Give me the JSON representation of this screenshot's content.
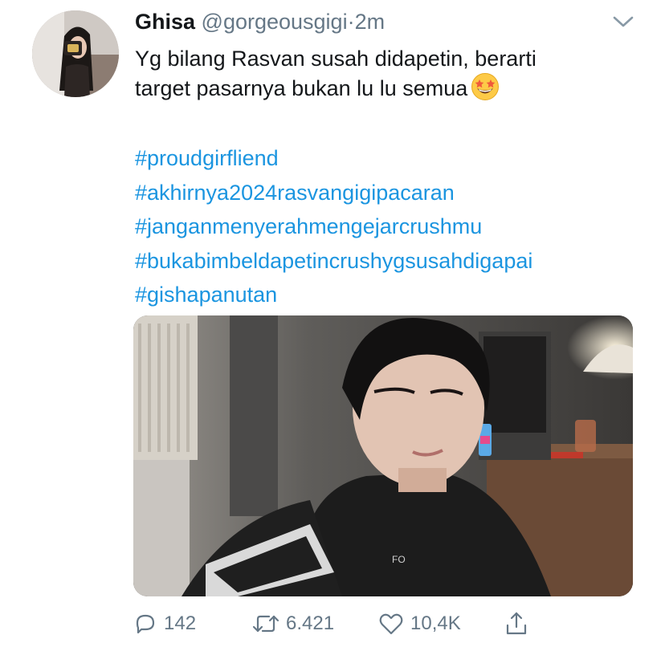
{
  "tweet": {
    "author_name": "Ghisa",
    "author_handle": "@gorgeousgigi",
    "separator": "·",
    "time": "2m",
    "text_lines": [
      "Yg bilang Rasvan susah didapetin, berarti",
      "target pasarnya bukan lu lu semua"
    ],
    "emoji": "star-struck-emoji",
    "hashtags": [
      "#proudgirfliend",
      "#akhirnya2024rasvangigipacaran",
      "#janganmenyerahmengejarcrushmu",
      "#bukabimbeldapetincrushygsusahdigapai",
      "#gishapanutan"
    ]
  },
  "actions": {
    "replies": "142",
    "retweets": "6.421",
    "likes": "10,4K"
  },
  "icons": {
    "reply": "reply-icon",
    "retweet": "retweet-icon",
    "like": "heart-icon",
    "share": "share-icon",
    "more": "chevron-down-icon"
  },
  "colors": {
    "text": "#14171a",
    "secondary": "#657786",
    "link": "#1b95e0"
  }
}
